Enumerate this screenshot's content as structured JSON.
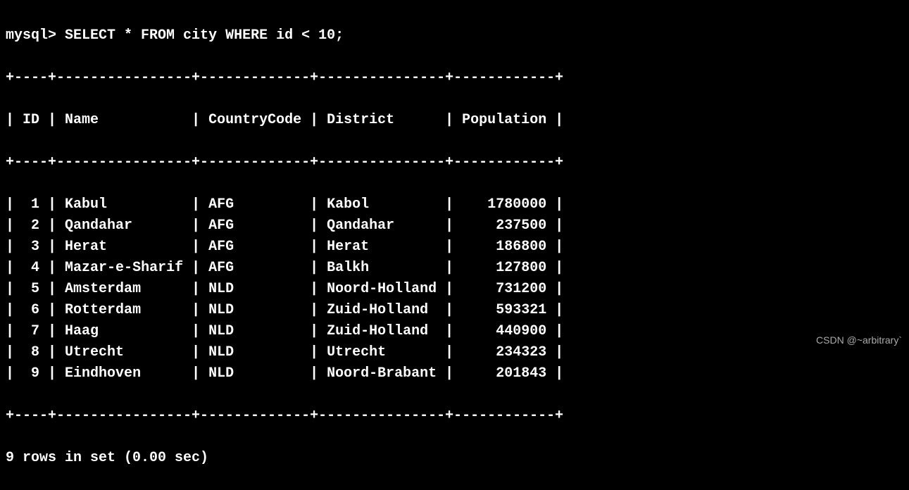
{
  "prompt": "mysql>",
  "query": "SELECT * FROM city WHERE id < 10;",
  "separator_top": "+----+----------------+-------------+---------------+------------+",
  "separator_mid": "+----+----------------+-------------+---------------+------------+",
  "separator_bottom": "+----+----------------+-------------+---------------+------------+",
  "headers": {
    "col1": "ID",
    "col2": "Name",
    "col3": "CountryCode",
    "col4": "District",
    "col5": "Population"
  },
  "rows": [
    {
      "id": "1",
      "name": "Kabul",
      "cc": "AFG",
      "district": "Kabol",
      "pop": "1780000"
    },
    {
      "id": "2",
      "name": "Qandahar",
      "cc": "AFG",
      "district": "Qandahar",
      "pop": "237500"
    },
    {
      "id": "3",
      "name": "Herat",
      "cc": "AFG",
      "district": "Herat",
      "pop": "186800"
    },
    {
      "id": "4",
      "name": "Mazar-e-Sharif",
      "cc": "AFG",
      "district": "Balkh",
      "pop": "127800"
    },
    {
      "id": "5",
      "name": "Amsterdam",
      "cc": "NLD",
      "district": "Noord-Holland",
      "pop": "731200"
    },
    {
      "id": "6",
      "name": "Rotterdam",
      "cc": "NLD",
      "district": "Zuid-Holland",
      "pop": "593321"
    },
    {
      "id": "7",
      "name": "Haag",
      "cc": "NLD",
      "district": "Zuid-Holland",
      "pop": "440900"
    },
    {
      "id": "8",
      "name": "Utrecht",
      "cc": "NLD",
      "district": "Utrecht",
      "pop": "234323"
    },
    {
      "id": "9",
      "name": "Eindhoven",
      "cc": "NLD",
      "district": "Noord-Brabant",
      "pop": "201843"
    }
  ],
  "footer": "9 rows in set (0.00 sec)",
  "watermark": "CSDN @~arbitrary`",
  "chart_data": {
    "type": "table",
    "title": "city",
    "columns": [
      "ID",
      "Name",
      "CountryCode",
      "District",
      "Population"
    ],
    "rows": [
      [
        1,
        "Kabul",
        "AFG",
        "Kabol",
        1780000
      ],
      [
        2,
        "Qandahar",
        "AFG",
        "Qandahar",
        237500
      ],
      [
        3,
        "Herat",
        "AFG",
        "Herat",
        186800
      ],
      [
        4,
        "Mazar-e-Sharif",
        "AFG",
        "Balkh",
        127800
      ],
      [
        5,
        "Amsterdam",
        "NLD",
        "Noord-Holland",
        731200
      ],
      [
        6,
        "Rotterdam",
        "NLD",
        "Zuid-Holland",
        593321
      ],
      [
        7,
        "Haag",
        "NLD",
        "Zuid-Holland",
        440900
      ],
      [
        8,
        "Utrecht",
        "NLD",
        "Utrecht",
        234323
      ],
      [
        9,
        "Eindhoven",
        "NLD",
        "Noord-Brabant",
        201843
      ]
    ]
  }
}
